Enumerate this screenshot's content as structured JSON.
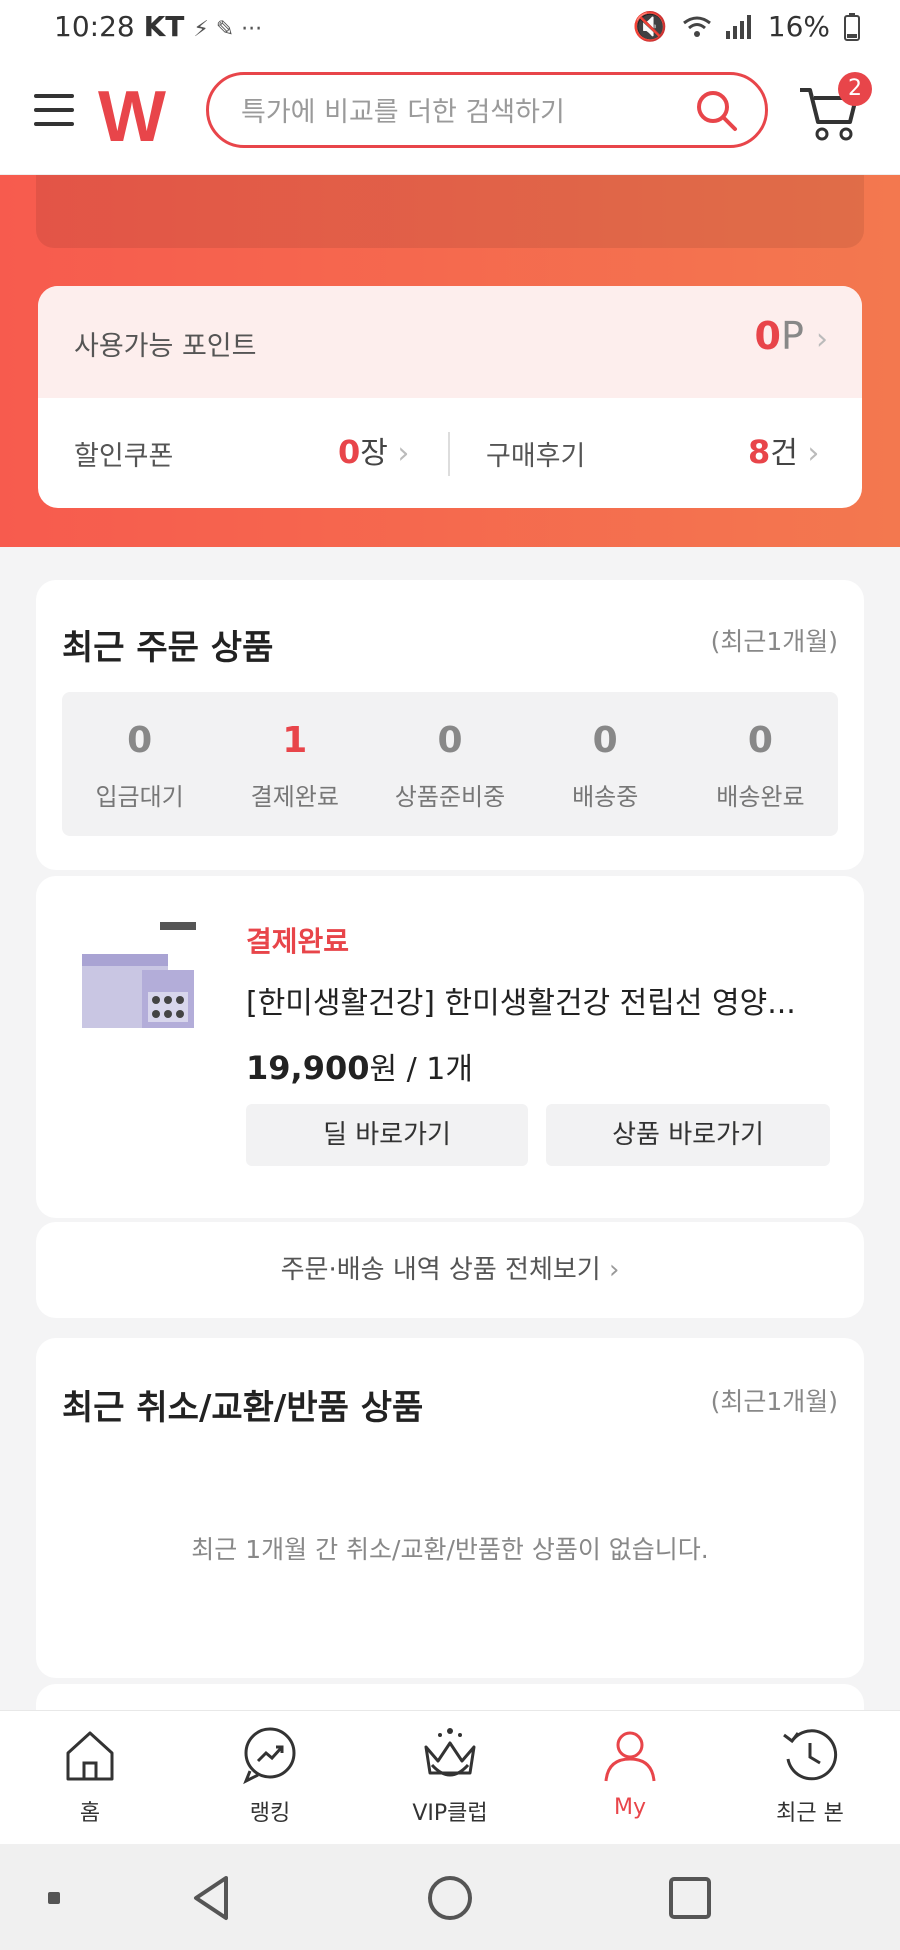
{
  "status_bar": {
    "time": "10:28",
    "carrier": "KT",
    "battery": "16%"
  },
  "header": {
    "logo": "W",
    "search_placeholder": "특가에 비교를 더한 검색하기",
    "cart_count": "2"
  },
  "points": {
    "label": "사용가능 포인트",
    "value": "0",
    "unit": "P"
  },
  "coupon": {
    "label": "할인쿠폰",
    "value": "0",
    "unit": "장"
  },
  "reviews": {
    "label": "구매후기",
    "value": "8",
    "unit": "건"
  },
  "recent_orders": {
    "title": "최근 주문 상품",
    "period": "(최근1개월)",
    "steps": [
      {
        "count": "0",
        "label": "입금대기"
      },
      {
        "count": "1",
        "label": "결제완료"
      },
      {
        "count": "0",
        "label": "상품준비중"
      },
      {
        "count": "0",
        "label": "배송중"
      },
      {
        "count": "0",
        "label": "배송완료"
      }
    ]
  },
  "order_item": {
    "status": "결제완료",
    "name": "[한미생활건강] 한미생활건강 전립선 영양...",
    "price": "19,900",
    "price_suffix": "원 / 1개",
    "deal_button": "딜 바로가기",
    "product_button": "상품 바로가기"
  },
  "view_all": "주문·배송 내역 상품 전체보기",
  "cancel_section": {
    "title": "최근 취소/교환/반품 상품",
    "period": "(최근1개월)",
    "empty": "최근 1개월 간 취소/교환/반품한 상품이 없습니다."
  },
  "bottom_nav": [
    {
      "label": "홈",
      "icon": "home-icon"
    },
    {
      "label": "랭킹",
      "icon": "ranking-icon"
    },
    {
      "label": "VIP클럽",
      "icon": "crown-icon"
    },
    {
      "label": "My",
      "icon": "person-icon"
    },
    {
      "label": "최근 본",
      "icon": "history-icon"
    }
  ],
  "colors": {
    "accent": "#e8454a",
    "hero_start": "#f75b4e",
    "hero_end": "#f3784f"
  }
}
